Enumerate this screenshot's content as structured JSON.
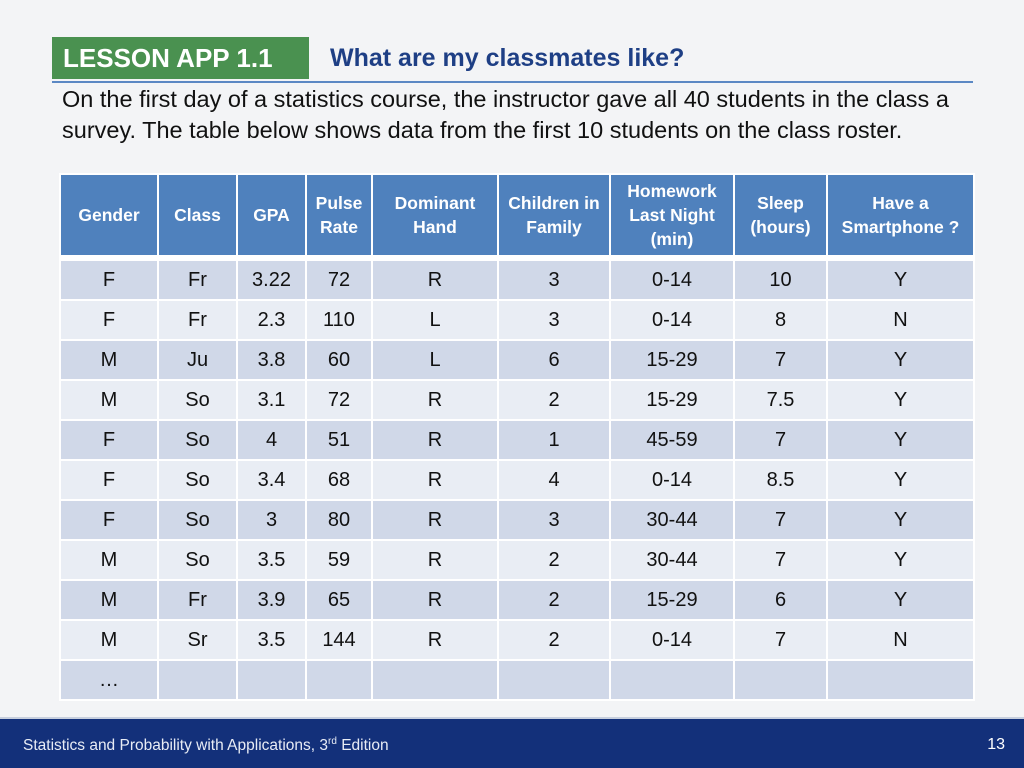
{
  "header": {
    "badge": "LESSON APP 1.1",
    "title": "What are my classmates like?"
  },
  "intro": "On the first day of a statistics course, the instructor gave all 40 students in the class a survey. The table below shows data from the first 10 students on the class roster.",
  "table": {
    "columns": [
      "Gender",
      "Class",
      "GPA",
      "Pulse Rate",
      "Dominant Hand",
      "Children in Family",
      "Homework Last Night (min)",
      "Sleep (hours)",
      "Have a Smartphone ?"
    ],
    "rows": [
      [
        "F",
        "Fr",
        "3.22",
        "72",
        "R",
        "3",
        "0-14",
        "10",
        "Y"
      ],
      [
        "F",
        "Fr",
        "2.3",
        "110",
        "L",
        "3",
        "0-14",
        "8",
        "N"
      ],
      [
        "M",
        "Ju",
        "3.8",
        "60",
        "L",
        "6",
        "15-29",
        "7",
        "Y"
      ],
      [
        "M",
        "So",
        "3.1",
        "72",
        "R",
        "2",
        "15-29",
        "7.5",
        "Y"
      ],
      [
        "F",
        "So",
        "4",
        "51",
        "R",
        "1",
        "45-59",
        "7",
        "Y"
      ],
      [
        "F",
        "So",
        "3.4",
        "68",
        "R",
        "4",
        "0-14",
        "8.5",
        "Y"
      ],
      [
        "F",
        "So",
        "3",
        "80",
        "R",
        "3",
        "30-44",
        "7",
        "Y"
      ],
      [
        "M",
        "So",
        "3.5",
        "59",
        "R",
        "2",
        "30-44",
        "7",
        "Y"
      ],
      [
        "M",
        "Fr",
        "3.9",
        "65",
        "R",
        "2",
        "15-29",
        "6",
        "Y"
      ],
      [
        "M",
        "Sr",
        "3.5",
        "144",
        "R",
        "2",
        "0-14",
        "7",
        "N"
      ],
      [
        "…",
        "",
        "",
        "",
        "",
        "",
        "",
        "",
        ""
      ]
    ]
  },
  "footer": {
    "book_title": "Statistics and Probability with Applications, 3",
    "edition_sup": "rd",
    "edition_word": " Edition",
    "page_number": "13"
  },
  "colors": {
    "badge_green": "#4a9150",
    "title_blue": "#1e3f85",
    "header_blue": "#4f81bd",
    "row_dark": "#d0d8e8",
    "row_light": "#e9edf4",
    "footer_navy": "#13307a"
  }
}
